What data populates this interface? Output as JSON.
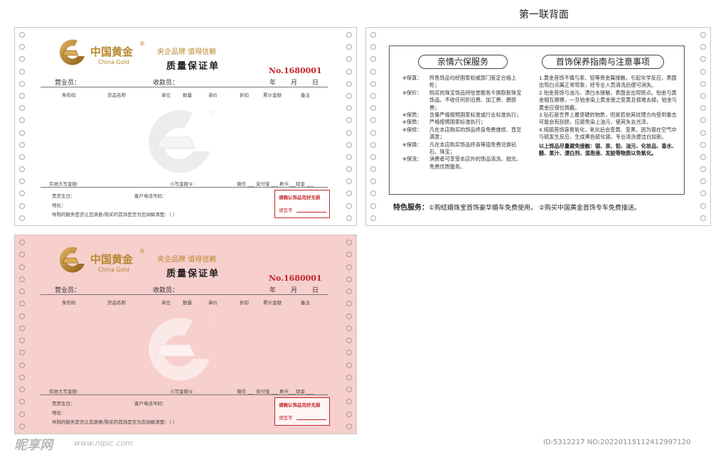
{
  "caption": "第一联背面",
  "receipt": {
    "brand_cn": "中国黄金",
    "brand_en": "China Gold",
    "reg_mark": "®",
    "slogan": "央企品牌  值得信赖",
    "title": "质量保证单",
    "serial": "No.1680001",
    "salesperson_label": "营业员：",
    "cashier_label": "收款员：",
    "year_label": "年",
    "month_label": "月",
    "day_label": "日",
    "columns": [
      "条形码",
      "货品名称",
      "单位",
      "数量",
      "单价",
      "折扣",
      "累计金额",
      "备注"
    ],
    "total_upper_label": "实收大写金额:",
    "total_lower_label": "小写金额￥:",
    "payment_line": "微信 ___ 支付宝 ___ 刷卡___现金 ___",
    "birthday_label": "贵宾生日：",
    "phone_label": "客户电话号码：",
    "address_label": "地址：",
    "satisfaction": "导购的服务是否让您满意/购买的首饰是否为您讲解清楚：（          ）",
    "stamp_text": "请确认饰品完好无损",
    "stamp_sign": "请签字"
  },
  "back": {
    "left_heading": "亲情六保服务",
    "right_heading": "首饰保养指南与注意事项",
    "services": [
      {
        "key": "※保真：",
        "text": "所售饰品均经国家权威部门鉴定合格上柜；"
      },
      {
        "key": "※保价：",
        "text": "购买的珠宝饰品持信誉服务卡换取新珠宝饰品。不收任何折旧费、加工费、磨损费；"
      },
      {
        "key": "※保质：",
        "text": "含量严格按照国家标准或行业标准执行；"
      },
      {
        "key": "※保质：",
        "text": "严格按照国家标准执行；"
      },
      {
        "key": "※保修：",
        "text": "凡在本店购买的饰品终身免费维修、直至满意；"
      },
      {
        "key": "※保换：",
        "text": "凡在本店购买饰品终身等值免费兑换钻石、珠宝；"
      },
      {
        "key": "※保洗：",
        "text": "消费者可享受本店外的饰品清洗、抛光、免费优质服务。"
      }
    ],
    "care": [
      "1.黄金首饰不慎与汞、铅等贵金属接触，引起化学反应，表面出现白点属正常现象，经专业人员清洗后便可消失。",
      "2.铂金首饰与油污、漂白水接触，表面会出现斑点。铂金与黄金相互摩擦，一旦铂金染上黄金使之变黄且很难去掉。铂金与黄金应错位佩戴。",
      "3.钻石是世界上最坚硬的物质，但是若依其纹理方向受到重击可能会有刮损，应避免染上油污，使其失去光泽。",
      "4.纯银首饰容易氧化，氧化后会变黄、变黑，因为银在空气中与硫发生反应，生成黑色硫化银。专业清洗便洁白如新。"
    ],
    "care_note": "以上饰品尽量避免接触：银、汞、铅、油污、化妆品、香水、醋、果汁、漂白剂、湿孢液、发胶等物质以免氧化。",
    "special_label": "特色服务：",
    "special_text": "①购结婚珠宝首饰豪华婚车免费使用。   ②购买中国黄金首饰专车免费接送。"
  },
  "footer": {
    "brand": "昵享网",
    "url": "www.nipic.com",
    "id": "ID:5312217 NO:20220115112412997120"
  },
  "colors": {
    "gold": "#b8862b",
    "serial_red": "#c0252a",
    "pink_bg": "#f7cfcd"
  }
}
